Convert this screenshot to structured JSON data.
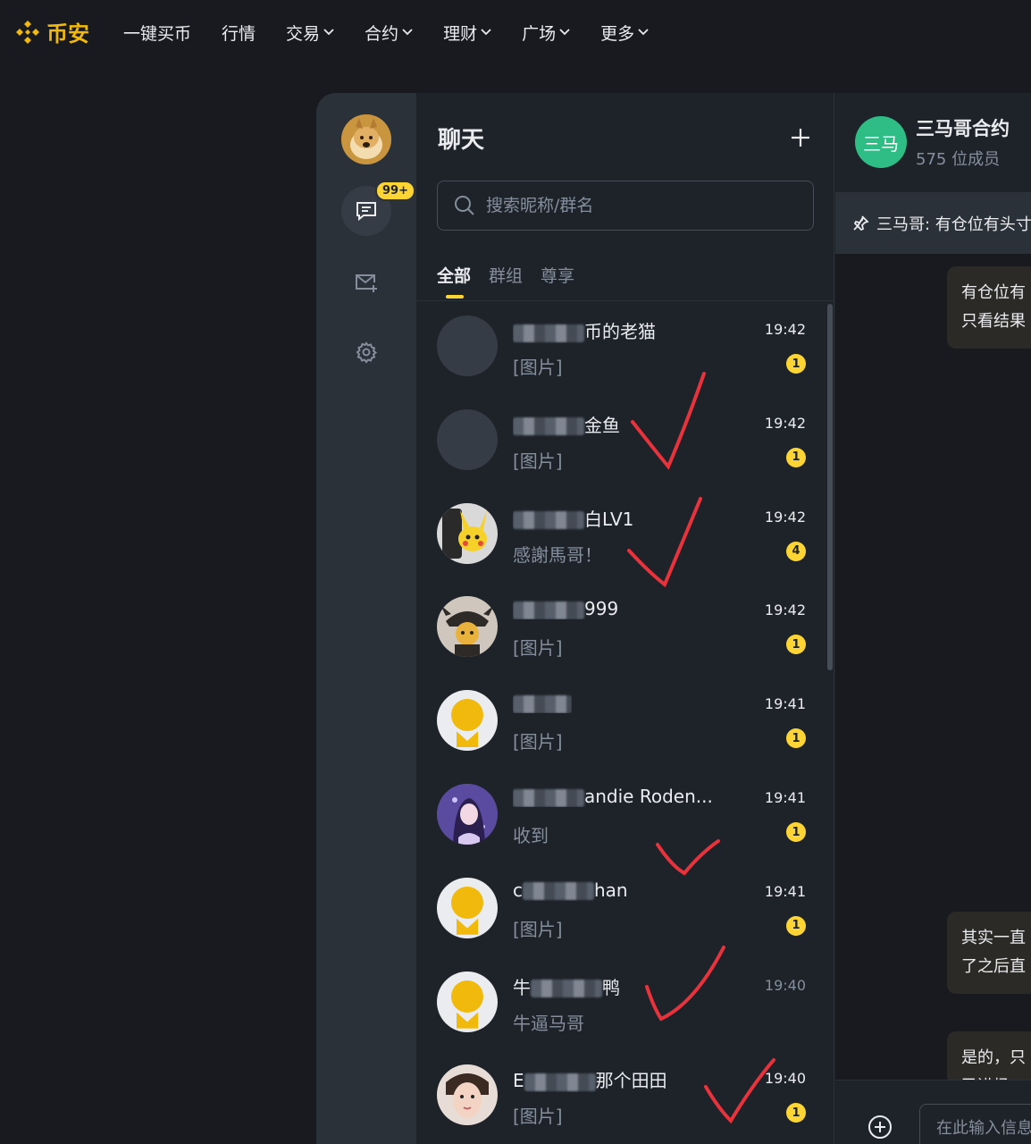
{
  "brand": {
    "name": "币安"
  },
  "nav": [
    {
      "label": "一键买币",
      "dropdown": false
    },
    {
      "label": "行情",
      "dropdown": false
    },
    {
      "label": "交易",
      "dropdown": true
    },
    {
      "label": "合约",
      "dropdown": true
    },
    {
      "label": "理财",
      "dropdown": true
    },
    {
      "label": "广场",
      "dropdown": true
    },
    {
      "label": "更多",
      "dropdown": true
    }
  ],
  "rail": {
    "unread_badge": "99+"
  },
  "chat_list": {
    "title": "聊天",
    "search_placeholder": "搜索昵称/群名",
    "tabs": [
      {
        "label": "全部",
        "active": true
      },
      {
        "label": "群组",
        "active": false
      },
      {
        "label": "尊享",
        "active": false
      }
    ],
    "conversations": [
      {
        "name_prefix": "",
        "name_suffix": "币的老猫",
        "preview": "[图片]",
        "time": "19:42",
        "unread": "1",
        "avatar": "blank"
      },
      {
        "name_prefix": "",
        "name_suffix": "金鱼",
        "preview": "[图片]",
        "time": "19:42",
        "unread": "1",
        "avatar": "blank"
      },
      {
        "name_prefix": "",
        "name_suffix": "白LV1",
        "preview": "感謝馬哥！",
        "time": "19:42",
        "unread": "4",
        "avatar": "pikachu"
      },
      {
        "name_prefix": "",
        "name_suffix": "999",
        "preview": "[图片]",
        "time": "19:42",
        "unread": "1",
        "avatar": "warrior"
      },
      {
        "name_prefix": "",
        "name_suffix": "",
        "preview": "[图片]",
        "time": "19:41",
        "unread": "1",
        "avatar": "default"
      },
      {
        "name_prefix": "",
        "name_suffix": "andie Roden...",
        "preview": "收到",
        "time": "19:41",
        "unread": "1",
        "avatar": "anime"
      },
      {
        "name_prefix": "c",
        "name_suffix": "han",
        "preview": "[图片]",
        "time": "19:41",
        "unread": "1",
        "avatar": "default"
      },
      {
        "name_prefix": "牛",
        "name_suffix": "鸭",
        "preview": "牛逼马哥",
        "time": "19:40",
        "unread": "",
        "avatar": "default"
      },
      {
        "name_prefix": "E",
        "name_suffix": "那个田田",
        "preview": "[图片]",
        "time": "19:40",
        "unread": "1",
        "avatar": "photo"
      }
    ]
  },
  "group": {
    "avatar_text": "三马",
    "name": "三马哥合约",
    "members": "575 位成员",
    "pinned": "三马哥: 有仓位有头寸",
    "messages": [
      {
        "lines": [
          "有仓位有",
          "只看结果"
        ]
      },
      {
        "lines": [
          "其实一直",
          "了之后直"
        ]
      },
      {
        "lines": [
          "是的，只",
          "已进场"
        ]
      }
    ],
    "input_placeholder": "在此输入信息"
  },
  "colors": {
    "accent": "#fcd535",
    "brand": "#f0b90b",
    "background": "#181a20",
    "panel": "#1e2329",
    "annotation": "#e8323c"
  }
}
